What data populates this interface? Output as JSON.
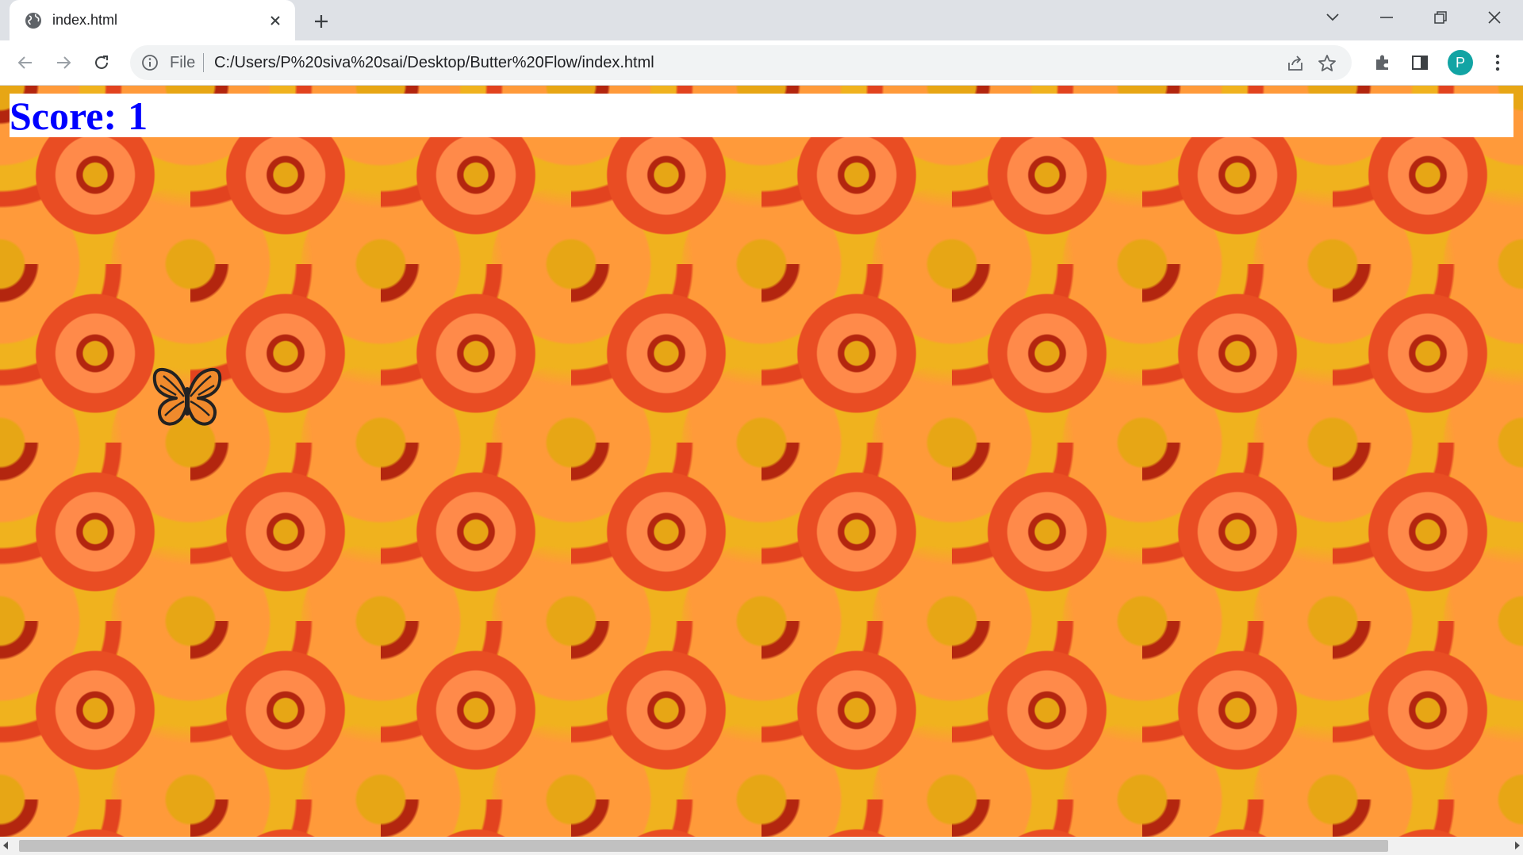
{
  "browser": {
    "tab_title": "index.html",
    "address_scheme": "File",
    "address_url": "C:/Users/P%20siva%20sai/Desktop/Butter%20Flow/index.html",
    "profile_initial": "P",
    "profile_color": "#12a4a4"
  },
  "game": {
    "score_label": "Score:",
    "score_value": "1",
    "score_color": "#0000ff",
    "player_icon": "butterfly-icon",
    "background": "tiled orange-red gaillardia flowers"
  }
}
